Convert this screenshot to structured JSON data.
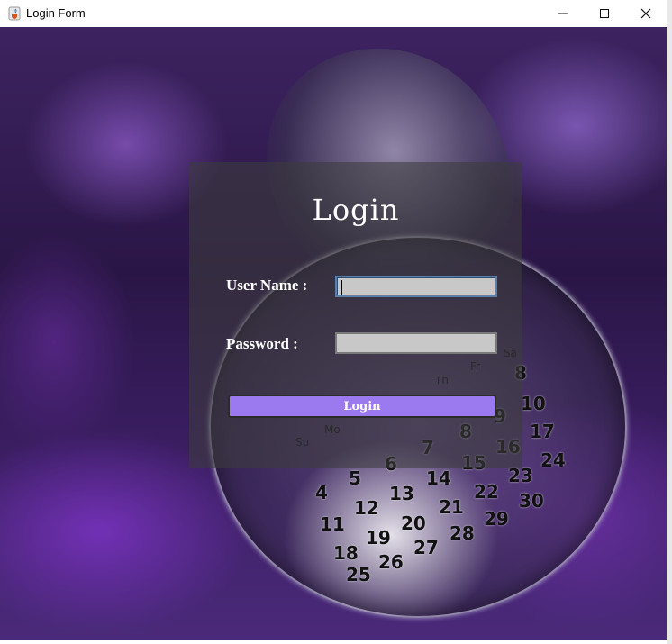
{
  "window": {
    "title": "Login Form"
  },
  "icons": {
    "app": "java-cup-icon",
    "minimize": "minimize-icon",
    "maximize": "maximize-icon",
    "close": "close-icon"
  },
  "form": {
    "heading": "Login",
    "username_label": "User Name :",
    "username_value": "",
    "password_label": "Password :",
    "password_value": "",
    "login_button": "Login"
  },
  "background_calendar": {
    "days": [
      "Su",
      "Mo",
      "Th",
      "Fr",
      "Sa"
    ],
    "numbers": [
      "8",
      "9",
      "10",
      "4",
      "5",
      "6",
      "7",
      "8",
      "11",
      "12",
      "13",
      "14",
      "15",
      "16",
      "17",
      "18",
      "19",
      "20",
      "21",
      "22",
      "23",
      "24",
      "25",
      "26",
      "27",
      "28",
      "29",
      "30"
    ]
  },
  "colors": {
    "button": "#9b7af0",
    "panel": "rgba(60,60,60,0.58)",
    "input": "#c8c8c8"
  }
}
